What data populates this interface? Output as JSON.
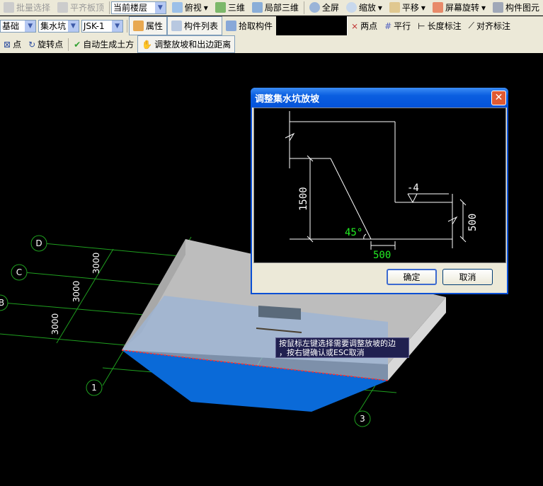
{
  "toolbar1": {
    "batch_select": "批量选择",
    "align_top": "平齐板顶",
    "floor_select": "当前楼层",
    "top_view": "俯视",
    "three_d": "三维",
    "local_3d": "局部三维",
    "fullscreen": "全屏",
    "zoom": "缩放",
    "pan": "平移",
    "rotate": "屏幕旋转",
    "component_view": "构件图元"
  },
  "toolbar2": {
    "category": "基础",
    "type": "集水坑",
    "component": "JSK-1",
    "properties": "属性",
    "component_list": "构件列表",
    "pick_component": "拾取构件",
    "two_points": "两点",
    "parallel": "平行",
    "length_dim": "长度标注",
    "aligned_dim": "对齐标注"
  },
  "toolbar3": {
    "point": "点",
    "rotate_point": "旋转点",
    "auto_earthwork": "自动生成土方",
    "adjust_slope": "调整放坡和出边距离"
  },
  "dialog": {
    "title": "调整集水坑放坡",
    "depth": "1500",
    "elevation": "-4",
    "angle": "45°",
    "offset": "500",
    "pit_depth": "500",
    "ok": "确定",
    "cancel": "取消"
  },
  "scene": {
    "axes": {
      "d": "D",
      "c": "C",
      "b": "B",
      "one": "1",
      "three": "3"
    },
    "dims": [
      "3000",
      "3000",
      "3000"
    ]
  },
  "tooltip": {
    "line1": "按鼠标左键选择需要调整放坡的边",
    "line2": "，按右键确认或ESC取消"
  },
  "colors": {
    "slab": "#bdbdbd",
    "pit": "#0a6ad8",
    "grid": "#1fa01f",
    "highlight": "#00ff00"
  }
}
